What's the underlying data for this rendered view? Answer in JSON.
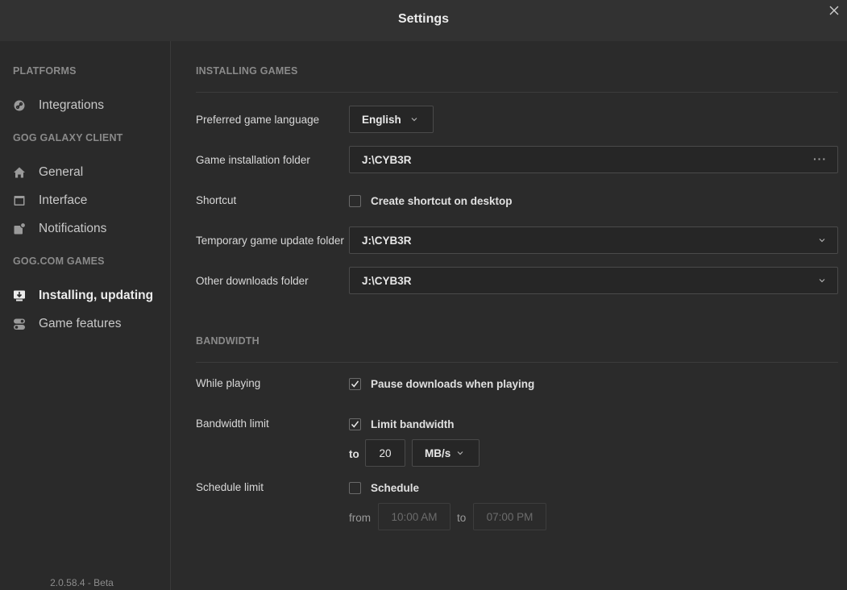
{
  "window": {
    "title": "Settings",
    "close_icon": "close-icon"
  },
  "sidebar": {
    "sections": {
      "platforms": "PLATFORMS",
      "client": "GOG GALAXY CLIENT",
      "games": "GOG.COM GAMES"
    },
    "items": {
      "integrations": {
        "label": "Integrations",
        "icon": "link-icon"
      },
      "general": {
        "label": "General",
        "icon": "home-icon"
      },
      "interface": {
        "label": "Interface",
        "icon": "window-icon"
      },
      "notifications": {
        "label": "Notifications",
        "icon": "bell-icon"
      },
      "installing": {
        "label": "Installing, updating",
        "icon": "download-icon",
        "active": true
      },
      "features": {
        "label": "Game features",
        "icon": "toggle-icon"
      }
    },
    "version": "2.0.58.4 - Beta"
  },
  "installing": {
    "title": "INSTALLING GAMES",
    "language": {
      "label": "Preferred game language",
      "value": "English"
    },
    "install_folder": {
      "label": "Game installation folder",
      "value": "J:\\CYB3R",
      "more": "···"
    },
    "shortcut": {
      "label": "Shortcut",
      "checkbox_label": "Create shortcut on desktop",
      "checked": false
    },
    "temp_folder": {
      "label": "Temporary game update folder",
      "value": "J:\\CYB3R"
    },
    "other_folder": {
      "label": "Other downloads folder",
      "value": "J:\\CYB3R"
    }
  },
  "bandwidth": {
    "title": "BANDWIDTH",
    "while_playing": {
      "label": "While playing",
      "checkbox_label": "Pause downloads when playing",
      "checked": true
    },
    "limit": {
      "label": "Bandwidth limit",
      "checkbox_label": "Limit bandwidth",
      "checked": true,
      "to_label": "to",
      "value": "20",
      "unit": "MB/s"
    },
    "schedule": {
      "label": "Schedule limit",
      "checkbox_label": "Schedule",
      "checked": false,
      "from_label": "from",
      "from_value": "10:00 AM",
      "to_label": "to",
      "to_value": "07:00 PM"
    }
  },
  "colors": {
    "background": "#2b2b2b",
    "titlebar": "#323232",
    "border": "#4a4a4a"
  }
}
